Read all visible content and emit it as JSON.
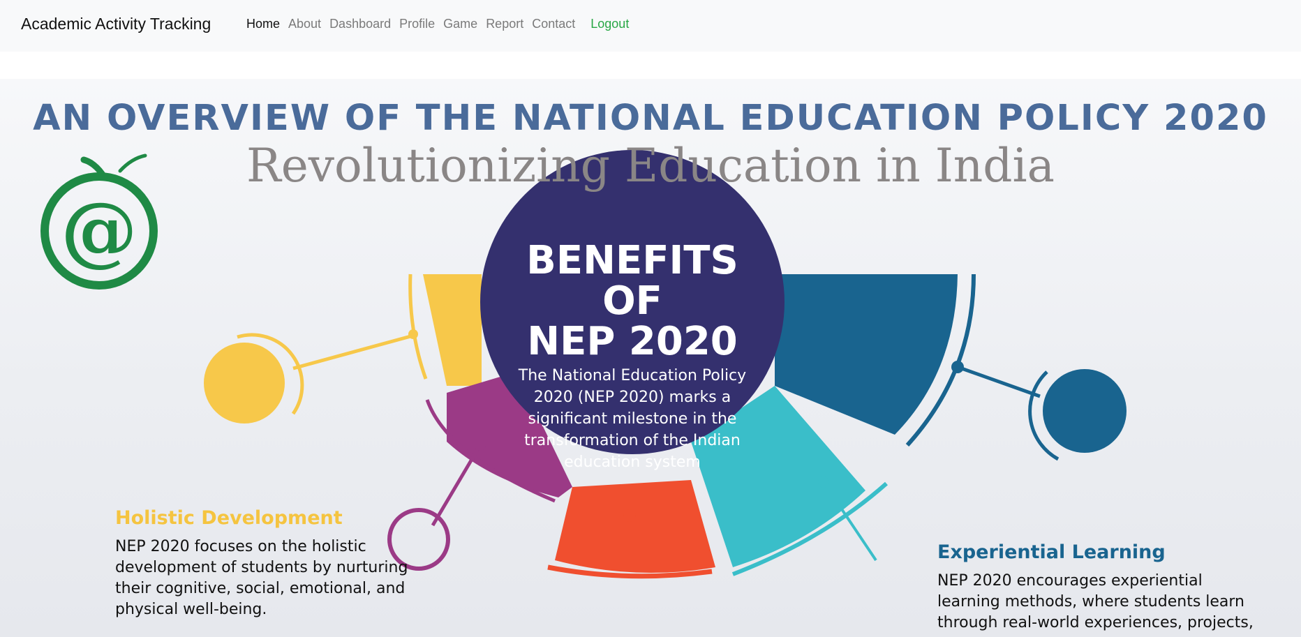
{
  "navbar": {
    "brand": "Academic Activity Tracking",
    "links": [
      "Home",
      "About",
      "Dashboard",
      "Profile",
      "Game",
      "Report",
      "Contact"
    ],
    "logout": "Logout"
  },
  "hero": {
    "title": "AN OVERVIEW OF THE NATIONAL EDUCATION POLICY 2020",
    "subtitle": "Revolutionizing Education in India",
    "logo_glyph": "@",
    "center_title": "BENEFITS\nOF\nNEP 2020",
    "center_text": "The National Education Policy 2020 (NEP 2020) marks a significant milestone in the transformation of the Indian education system",
    "left_heading": "Holistic Development",
    "left_text": "NEP 2020 focuses on the holistic development of students by nurturing their cognitive, social, emotional, and physical well-being.",
    "right_heading": "Experiential Learning",
    "right_text": "NEP 2020 encourages experiential learning methods, where students learn through real-world experiences, projects,"
  },
  "colors": {
    "navbar_bg": "#f8f9fa",
    "logout": "#28a745",
    "title": "#4a6b9a",
    "center_circle": "#34306e",
    "yellow": "#f7c84a",
    "purple": "#9b3a86",
    "orange": "#f04f2f",
    "teal": "#3abec9",
    "blue": "#19648f",
    "logo_green": "#1f8a45"
  }
}
